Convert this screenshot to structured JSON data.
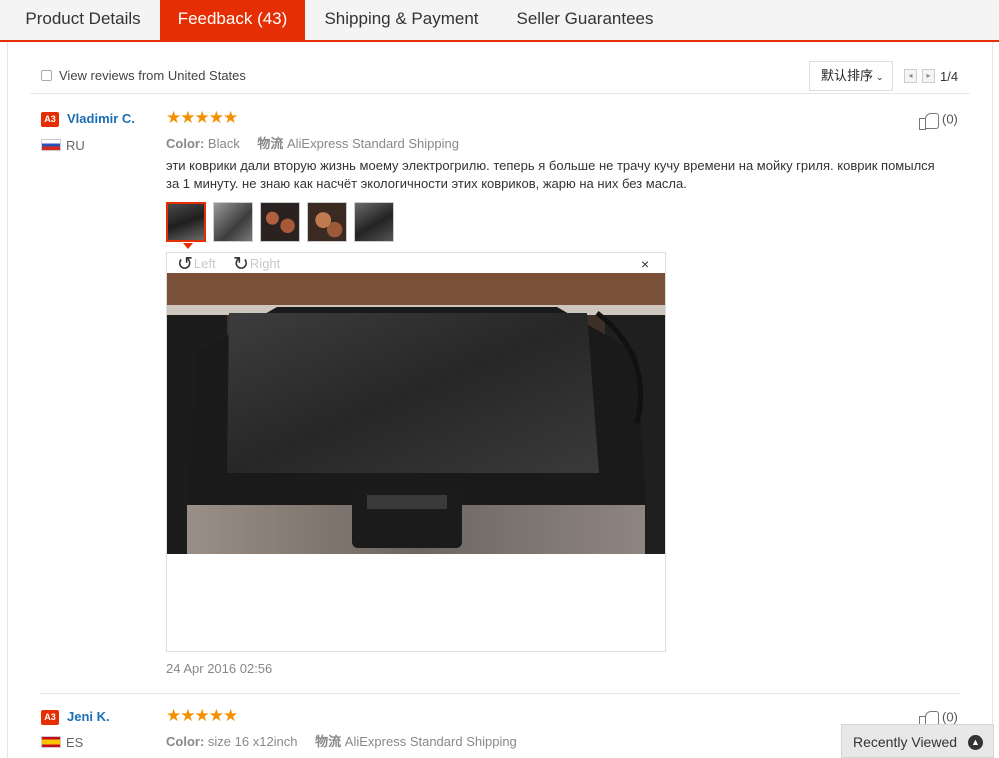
{
  "tabs": [
    {
      "label": "Product Details"
    },
    {
      "label": "Feedback (43)"
    },
    {
      "label": "Shipping & Payment"
    },
    {
      "label": "Seller Guarantees"
    }
  ],
  "filter": {
    "checkbox_label": "View reviews from United States",
    "sort_label": "默认排序",
    "prev_glyph": "◂",
    "next_glyph": "▸",
    "page": "1/4"
  },
  "reviews": [
    {
      "badge": "A3",
      "name": "Vladimir C.",
      "country": "RU",
      "stars": "★★★★★",
      "color_key": "Color:",
      "color_value": "Black",
      "shipping_key": "物流",
      "shipping_value": "AliExpress Standard Shipping",
      "likes": "(0)",
      "text": "эти коврики дали вторую жизнь моему электрогрилю. теперь я больше не трачу кучу времени на мойку гриля. коврик помылся за 1 минуту. не знаю как насчёт экологичности этих ковриков, жарю на них без масла.",
      "viewer": {
        "left": "Left",
        "right": "Right",
        "close": "×"
      },
      "date": "24 Apr 2016 02:56"
    },
    {
      "badge": "A3",
      "name": "Jeni K.",
      "country": "ES",
      "stars": "★★★★★",
      "color_key": "Color:",
      "color_value": "size 16 x12inch",
      "shipping_key": "物流",
      "shipping_value": "AliExpress Standard Shipping",
      "likes": "(0)"
    }
  ],
  "recently_viewed": {
    "label": "Recently Viewed"
  }
}
